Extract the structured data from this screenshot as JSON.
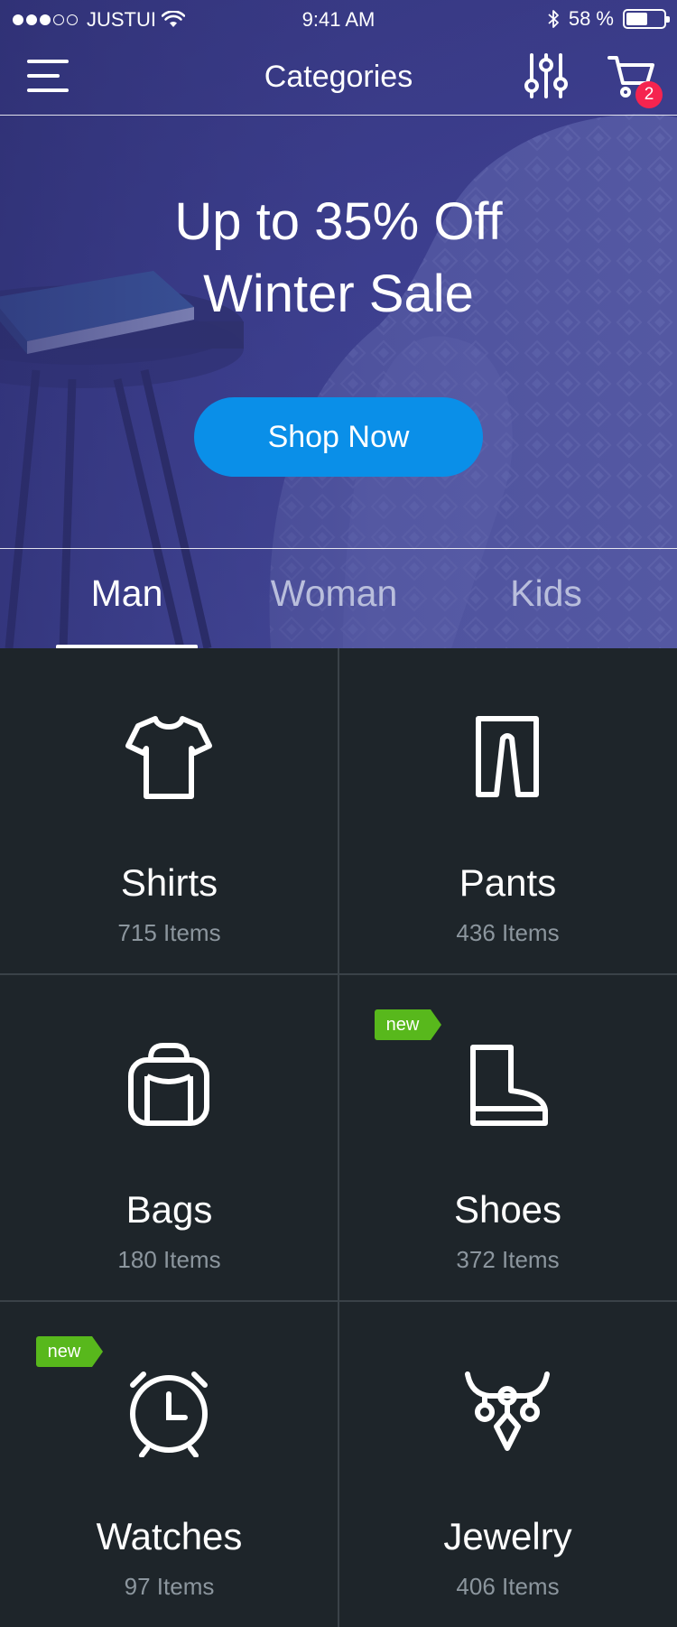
{
  "status_bar": {
    "carrier": "JUSTUI",
    "time": "9:41 AM",
    "battery_text": "58 %",
    "battery_level": 0.58,
    "signal_icon": "signal-dots-icon",
    "wifi_icon": "wifi-icon",
    "bluetooth_icon": "bluetooth-icon"
  },
  "nav": {
    "title": "Categories",
    "menu_icon": "hamburger-menu-icon",
    "filter_icon": "sliders-icon",
    "cart_icon": "cart-icon",
    "cart_count": "2"
  },
  "promo": {
    "line1": "Up to 35% Off",
    "line2": "Winter Sale",
    "button_label": "Shop Now"
  },
  "tabs": [
    {
      "label": "Man",
      "active": true
    },
    {
      "label": "Woman",
      "active": false
    },
    {
      "label": "Kids",
      "active": false
    }
  ],
  "categories": [
    {
      "name": "Shirts",
      "count": "715 Items",
      "icon": "shirt-icon"
    },
    {
      "name": "Pants",
      "count": "436 Items",
      "icon": "pants-icon"
    },
    {
      "name": "Bags",
      "count": "180 Items",
      "icon": "bag-icon"
    },
    {
      "name": "Shoes",
      "count": "372 Items",
      "icon": "boot-icon",
      "badge": "new"
    },
    {
      "name": "Watches",
      "count": "97 Items",
      "icon": "watch-icon",
      "badge": "new"
    },
    {
      "name": "Jewelry",
      "count": "406 Items",
      "icon": "necklace-icon"
    }
  ],
  "colors": {
    "hero_bg": "#3b3d8c",
    "accent_button": "#0a8fe8",
    "badge_red": "#f5244f",
    "badge_new_green": "#58b81c",
    "grid_bg": "#1e252a"
  }
}
